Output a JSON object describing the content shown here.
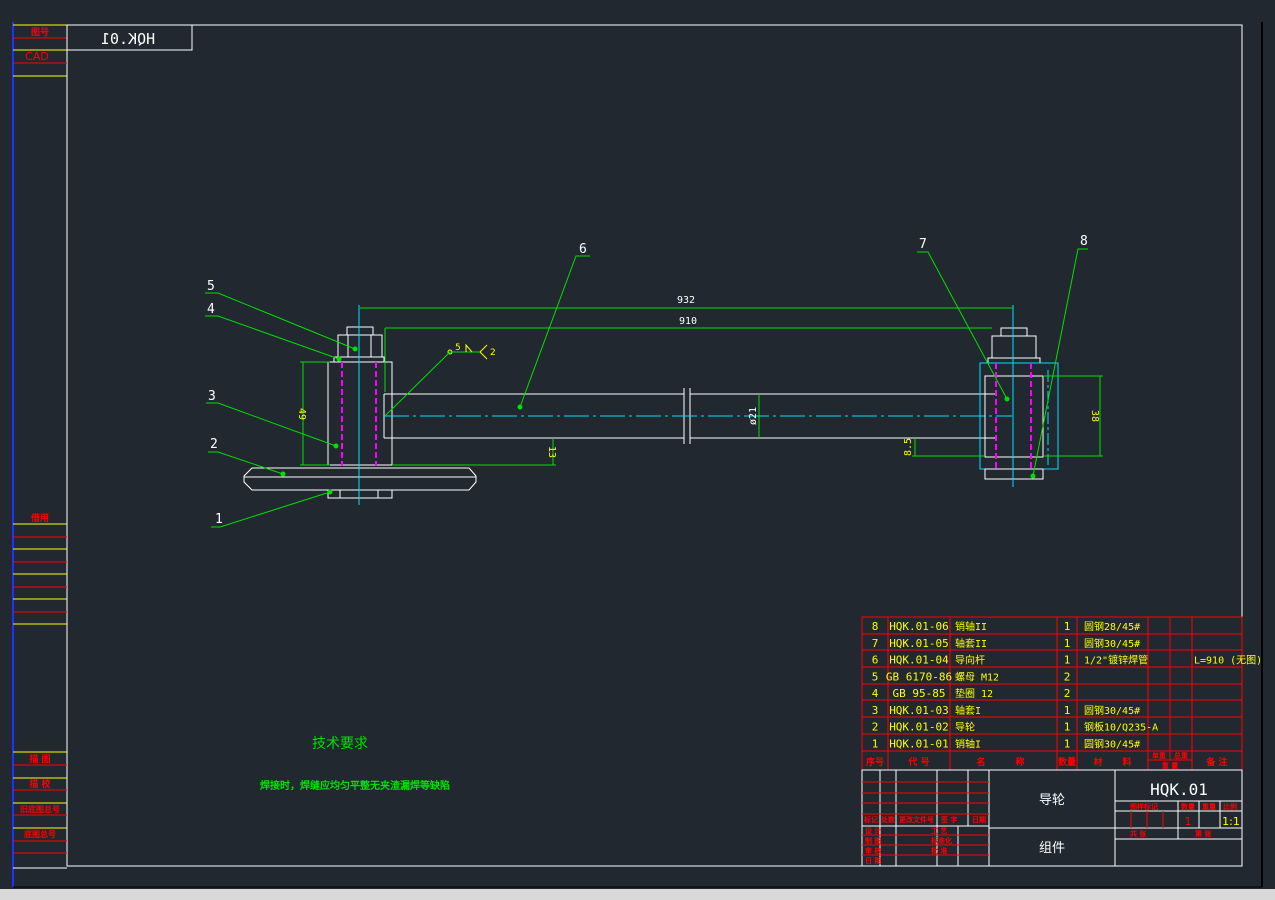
{
  "drawing_number_mirrored": "HQK.01",
  "left_strip": {
    "top_labels": [
      "图号",
      "CAD"
    ],
    "mid_label": "借用",
    "bottom_labels": [
      "描 图",
      "描 校",
      "旧底图总号",
      "底图总号"
    ]
  },
  "balloons": [
    "1",
    "2",
    "3",
    "4",
    "5",
    "6",
    "7",
    "8"
  ],
  "dimensions": {
    "overall": "932",
    "pipe": "910",
    "block_height": "49",
    "offset": "13",
    "diameter": "ø21",
    "right_height": "38",
    "right_offset": "8.5"
  },
  "weld_symbol": {
    "leg": "5",
    "count": "2"
  },
  "tech_requirements": {
    "title": "技术要求",
    "text": "焊接时，焊缝应均匀平整无夹渣漏焊等缺陷"
  },
  "bom": {
    "rows": [
      {
        "no": "8",
        "code": "HQK.01-06",
        "name": "销轴II",
        "qty": "1",
        "material": "圆钢28/45#",
        "remark": ""
      },
      {
        "no": "7",
        "code": "HQK.01-05",
        "name": "轴套II",
        "qty": "1",
        "material": "圆钢30/45#",
        "remark": ""
      },
      {
        "no": "6",
        "code": "HQK.01-04",
        "name": "导向杆",
        "qty": "1",
        "material": "1/2\"镀锌焊管",
        "remark": "L=910 (无图)"
      },
      {
        "no": "5",
        "code": "GB 6170-86",
        "name": "螺母 M12",
        "qty": "2",
        "material": "",
        "remark": ""
      },
      {
        "no": "4",
        "code": "GB 95-85",
        "name": "垫圈 12",
        "qty": "2",
        "material": "",
        "remark": ""
      },
      {
        "no": "3",
        "code": "HQK.01-03",
        "name": "轴套I",
        "qty": "1",
        "material": "圆钢30/45#",
        "remark": ""
      },
      {
        "no": "2",
        "code": "HQK.01-02",
        "name": "导轮",
        "qty": "1",
        "material": "钢板10/Q235-A",
        "remark": ""
      },
      {
        "no": "1",
        "code": "HQK.01-01",
        "name": "销轴I",
        "qty": "1",
        "material": "圆钢30/45#",
        "remark": ""
      }
    ],
    "headers": {
      "no": "序号",
      "code": "代 号",
      "name1": "名",
      "name2": "称",
      "qty": "数量",
      "material1": "材",
      "material2": "料",
      "unit_weight": "单重",
      "total_weight": "总重",
      "weight": "重 量",
      "remark": "备 注"
    }
  },
  "title_block": {
    "name": "导轮",
    "type": "组件",
    "drawing_number": "HQK.01",
    "rev_headers": [
      "标记",
      "处数",
      "更改文件号",
      "签 字",
      "日期"
    ],
    "sign_labels": [
      "设 计",
      "制 图",
      "审 核",
      "日 期"
    ],
    "sign_labels2": [
      "工 艺",
      "标准化",
      "批 准"
    ],
    "stage_label": "图样标记",
    "qty_label": "数量",
    "weight_label": "重量",
    "scale_label": "比例",
    "qty": "1",
    "scale": "1:1",
    "sheet_label": "共 张",
    "page_label": "第 张"
  },
  "colors": {
    "background": "#212830",
    "white": "#ffffff",
    "green": "#00e000",
    "yellow": "#ffff00",
    "red": "#ff0000",
    "cyan": "#00e0ff",
    "magenta": "#ff00ff"
  }
}
